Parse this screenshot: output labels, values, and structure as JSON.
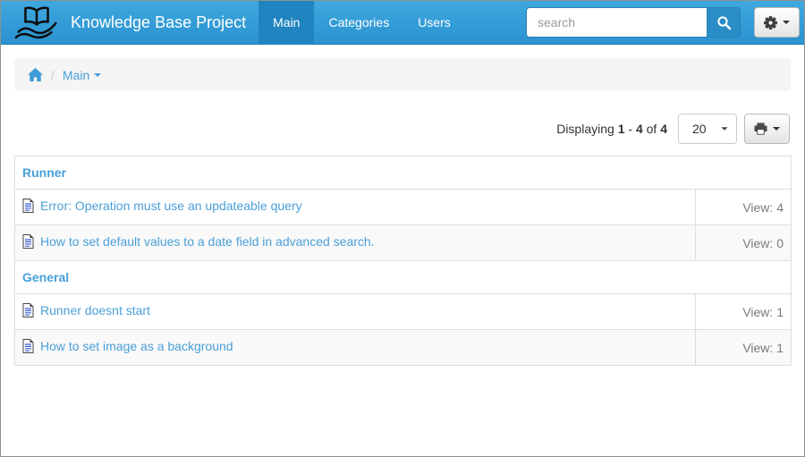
{
  "header": {
    "brand": "Knowledge Base Project",
    "nav_items": [
      {
        "label": "Main",
        "active": true
      },
      {
        "label": "Categories",
        "active": false
      },
      {
        "label": "Users",
        "active": false
      }
    ],
    "search": {
      "placeholder": "search",
      "value": ""
    },
    "icons": {
      "logo": "book-in-hand-logo",
      "search_button": "magnifier-icon",
      "settings_button": "gear-icon with caret-down"
    }
  },
  "breadcrumb": {
    "home_icon": "home-icon",
    "separator": "/",
    "current": "Main"
  },
  "toolbar": {
    "displaying": {
      "label": "Displaying",
      "start": "1",
      "dash": "-",
      "end": "4",
      "of": "of",
      "total": "4"
    },
    "page_size": "20",
    "print_button_icon": "printer-icon with caret-down"
  },
  "table": {
    "views_label": "View:",
    "row_icon": "document-icon",
    "groups": [
      {
        "category": "Runner",
        "items": [
          {
            "title": "Error: Operation must use an updateable query",
            "views": "4"
          },
          {
            "title": "How to set default values to a date field in advanced search.",
            "views": "0"
          }
        ]
      },
      {
        "category": "General",
        "items": [
          {
            "title": "Runner doesnt start",
            "views": "1"
          },
          {
            "title": "How to set image as a background",
            "views": "1"
          }
        ]
      }
    ]
  },
  "colors": {
    "navbar_top": "#3fa8de",
    "navbar_bottom": "#2a92d0",
    "nav_active": "#1f84bf",
    "search_button": "#2b8dc7",
    "link_blue": "#4a9fd8",
    "category_blue": "#46a0da",
    "stripe": "#f9f9f9",
    "breadcrumb_bg": "#f5f5f5",
    "table_border": "#dddddd"
  }
}
